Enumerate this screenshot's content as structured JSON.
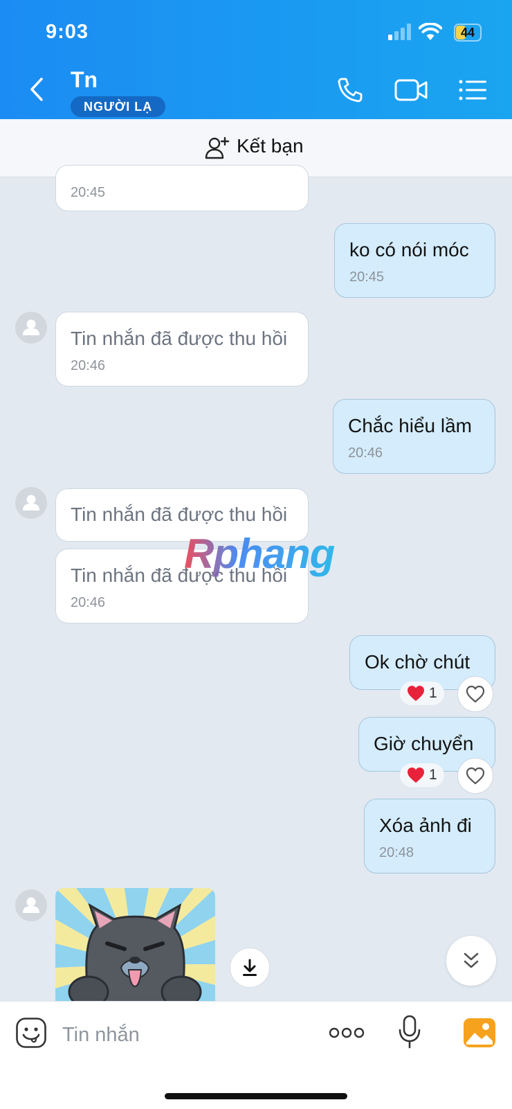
{
  "status_bar": {
    "time": "9:03",
    "battery_level": "44",
    "battery_fraction": 0.44
  },
  "header": {
    "contact_name": "Tn",
    "stranger_badge": "NGƯỜI LẠ",
    "icons": [
      "back-chevron-icon",
      "phone-icon",
      "video-call-icon",
      "menu-list-icon"
    ]
  },
  "friend_bar": {
    "label": "Kết bạn",
    "icon": "add-person-icon"
  },
  "messages": [
    {
      "direction": "received",
      "text": "",
      "time": "20:45"
    },
    {
      "direction": "sent",
      "text": "ko có nói móc",
      "time": "20:45"
    },
    {
      "direction": "received",
      "text": "Tin nhắn đã được thu hồi",
      "time": "20:46"
    },
    {
      "direction": "sent",
      "text": "Chắc hiểu lầm",
      "time": "20:46"
    },
    {
      "direction": "received",
      "text": "Tin nhắn đã được thu hồi",
      "time": ""
    },
    {
      "direction": "received",
      "text": "Tin nhắn đã được thu hồi",
      "time": "20:46"
    },
    {
      "direction": "sent",
      "text": "Ok chờ chút",
      "time": "",
      "reaction_count": "1"
    },
    {
      "direction": "sent",
      "text": "Giờ chuyển",
      "time": "",
      "reaction_count": "1"
    },
    {
      "direction": "sent",
      "text": "Xóa ảnh đi",
      "time": "20:48"
    },
    {
      "direction": "received",
      "type": "image",
      "description": "cat-sticker-image"
    }
  ],
  "watermark": "Rphang",
  "input_bar": {
    "placeholder": "Tin nhắn",
    "icons": [
      "emoji-icon",
      "more-options-icon",
      "microphone-icon",
      "image-gallery-icon"
    ]
  },
  "colors": {
    "header_start": "#1b8cf3",
    "header_end": "#1aa5f0",
    "sent_bubble": "#d4ecfc",
    "received_bubble": "#ffffff",
    "chat_background": "#e2e9f1",
    "badge": "#1469c4"
  }
}
